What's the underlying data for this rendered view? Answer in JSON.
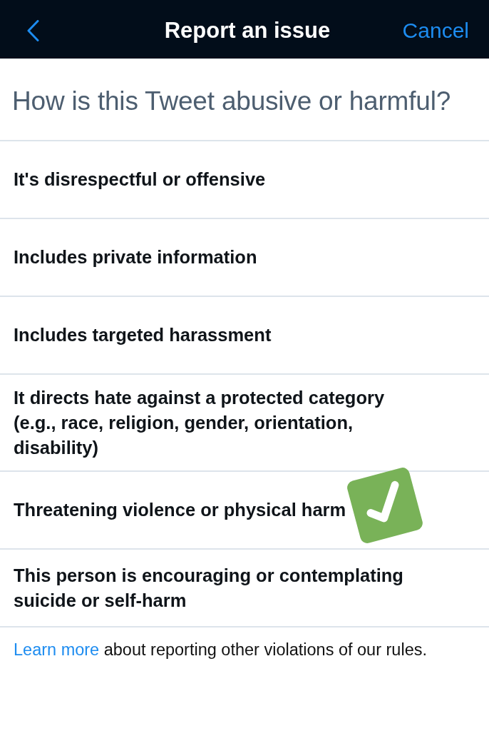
{
  "header": {
    "title": "Report an issue",
    "cancel": "Cancel"
  },
  "question": "How is this Tweet abusive or harmful?",
  "options": [
    {
      "label": "It's disrespectful or offensive",
      "selected": false
    },
    {
      "label": "Includes private information",
      "selected": false
    },
    {
      "label": "Includes targeted harassment",
      "selected": false
    },
    {
      "label": "It directs hate against a protected category (e.g., race, religion, gender, orientation, disability)",
      "selected": false
    },
    {
      "label": "Threatening violence or physical harm",
      "selected": true
    },
    {
      "label": "This person is encouraging or contemplating suicide or self-harm",
      "selected": false
    }
  ],
  "footer": {
    "link": "Learn more",
    "text": "about reporting other violations of our rules."
  }
}
